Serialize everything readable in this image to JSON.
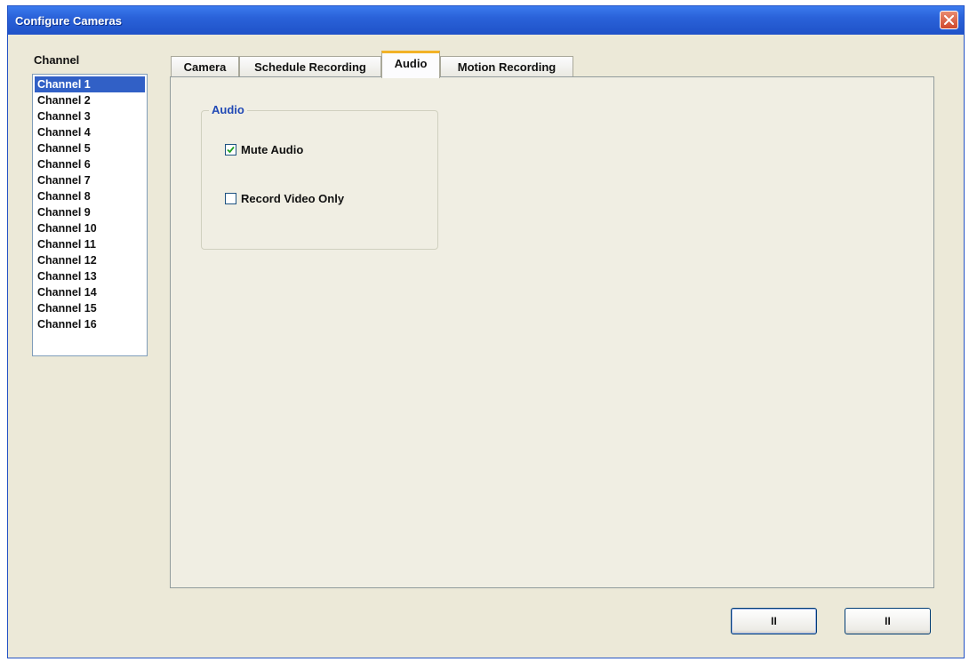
{
  "window": {
    "title": "Configure Cameras"
  },
  "channels": {
    "label": "Channel",
    "items": [
      "Channel 1",
      "Channel 2",
      "Channel 3",
      "Channel 4",
      "Channel 5",
      "Channel 6",
      "Channel 7",
      "Channel 8",
      "Channel 9",
      "Channel 10",
      "Channel 11",
      "Channel 12",
      "Channel 13",
      "Channel 14",
      "Channel 15",
      "Channel 16"
    ],
    "selected": "Channel 1"
  },
  "tabs": [
    {
      "label": "Camera",
      "active": false
    },
    {
      "label": "Schedule Recording",
      "active": false
    },
    {
      "label": "Audio",
      "active": true
    },
    {
      "label": "Motion Recording",
      "active": false
    }
  ],
  "audio_group": {
    "title": "Audio",
    "mute_audio": {
      "label": "Mute Audio",
      "checked": true
    },
    "record_video_only": {
      "label": "Record Video Only",
      "checked": false
    }
  },
  "buttons": {
    "ok_label": "II",
    "cancel_label": "II"
  },
  "colors": {
    "title_bar": "#2a62d9",
    "selection": "#3160c6",
    "group_title": "#2149b5",
    "active_tab_accent": "#f2b227",
    "close_button": "#d0482b"
  }
}
